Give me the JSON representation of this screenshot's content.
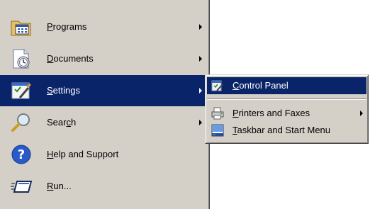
{
  "start_menu": {
    "items": [
      {
        "icon": "programs-folder-icon",
        "label_hot": "P",
        "label_rest": "rograms",
        "has_submenu": true
      },
      {
        "icon": "documents-icon",
        "label_hot": "D",
        "label_rest": "ocuments",
        "has_submenu": true
      },
      {
        "icon": "settings-icon",
        "label_hot": "S",
        "label_rest": "ettings",
        "has_submenu": true,
        "selected": true
      },
      {
        "icon": "search-icon",
        "label_pre": "Sear",
        "label_hot": "c",
        "label_rest": "h",
        "has_submenu": true
      },
      {
        "icon": "help-icon",
        "label_hot": "H",
        "label_rest": "elp and Support",
        "has_submenu": false
      },
      {
        "icon": "run-icon",
        "label_hot": "R",
        "label_rest": "un...",
        "has_submenu": false
      }
    ]
  },
  "settings_submenu": {
    "items": [
      {
        "icon": "control-panel-icon",
        "label_hot": "C",
        "label_rest": "ontrol Panel",
        "selected": true
      },
      {
        "icon": "printer-icon",
        "label_hot": "P",
        "label_rest": "rinters and Faxes",
        "has_submenu": true
      },
      {
        "icon": "taskbar-icon",
        "label_hot": "T",
        "label_rest": "askbar and Start Menu"
      }
    ]
  },
  "colors": {
    "menu_background": "#d4d0c8",
    "selection_background": "#0a246a",
    "selection_text": "#ffffff"
  }
}
